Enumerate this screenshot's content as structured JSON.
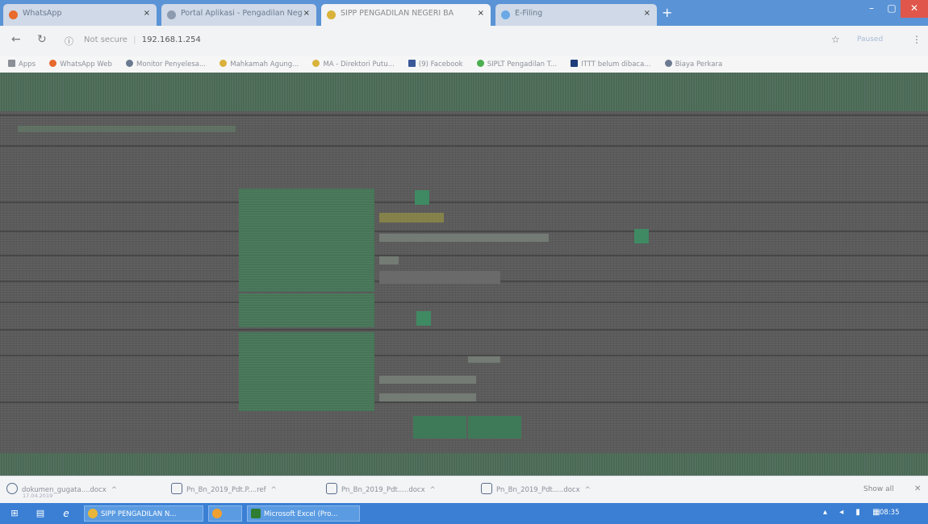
{
  "browser": {
    "tabs": [
      {
        "label": "WhatsApp",
        "icon": "whatsapp-icon",
        "color": "#e86a2c"
      },
      {
        "label": "Portal Aplikasi - Pengadilan Neg",
        "icon": "globe-icon",
        "color": "#6b7a90"
      },
      {
        "label": "SIPP PENGADILAN NEGERI BA",
        "icon": "scales-icon",
        "color": "#d9b23a"
      },
      {
        "label": "E-Filing",
        "icon": "efiling-icon",
        "color": "#6aa9e6"
      }
    ],
    "new_tab": "+",
    "window_controls": {
      "minimize": "–",
      "maximize": "▢",
      "close": "✕"
    },
    "address": {
      "security": "Not secure",
      "host": "192.168.1.254",
      "paused_label": "Paused"
    },
    "bookmarks": [
      {
        "label": "Apps",
        "icon": "apps-icon",
        "color": "#8b8f96"
      },
      {
        "label": "WhatsApp Web",
        "icon": "whatsapp-icon",
        "color": "#e86a2c"
      },
      {
        "label": "Monitor Penyelesa...",
        "icon": "globe-icon",
        "color": "#6b7a90"
      },
      {
        "label": "Mahkamah Agung...",
        "icon": "ma-icon",
        "color": "#d9b23a"
      },
      {
        "label": "MA - Direktori Putu...",
        "icon": "ma-icon",
        "color": "#d9b23a"
      },
      {
        "label": "(9) Facebook",
        "icon": "facebook-icon",
        "color": "#3b5998"
      },
      {
        "label": "SIPLT Pengadilan T...",
        "icon": "siplt-icon",
        "color": "#4caf50"
      },
      {
        "label": "ITTT belum dibaca...",
        "icon": "mail-icon",
        "color": "#1f3d7a"
      },
      {
        "label": "Biaya Perkara",
        "icon": "globe-icon",
        "color": "#6b7a90"
      }
    ]
  },
  "page": {
    "colors": {
      "header": "#4b6a56",
      "label": "#4b7a5c",
      "accent": "#3f8a63",
      "background": "#5b5b5b"
    }
  },
  "downloads": {
    "items": [
      {
        "name": "dokumen_gugata....docx",
        "sub": "17.04.2019"
      },
      {
        "name": "Pn_Bn_2019_Pdt.P....ref",
        "sub": ""
      },
      {
        "name": "Pn_Bn_2019_Pdt.....docx",
        "sub": ""
      },
      {
        "name": "Pn_Bn_2019_Pdt.....docx",
        "sub": ""
      }
    ],
    "show_all": "Show all",
    "close": "✕"
  },
  "taskbar": {
    "tasks": [
      {
        "label": "SIPP PENGADILAN N...",
        "icon": "chrome-icon",
        "color": "#e8b53a"
      },
      {
        "label": "",
        "icon": "app-icon",
        "color": "#f0a030"
      },
      {
        "label": "Microsoft Excel (Pro...",
        "icon": "excel-icon",
        "color": "#2e7d32"
      }
    ],
    "clock": "08:35"
  }
}
